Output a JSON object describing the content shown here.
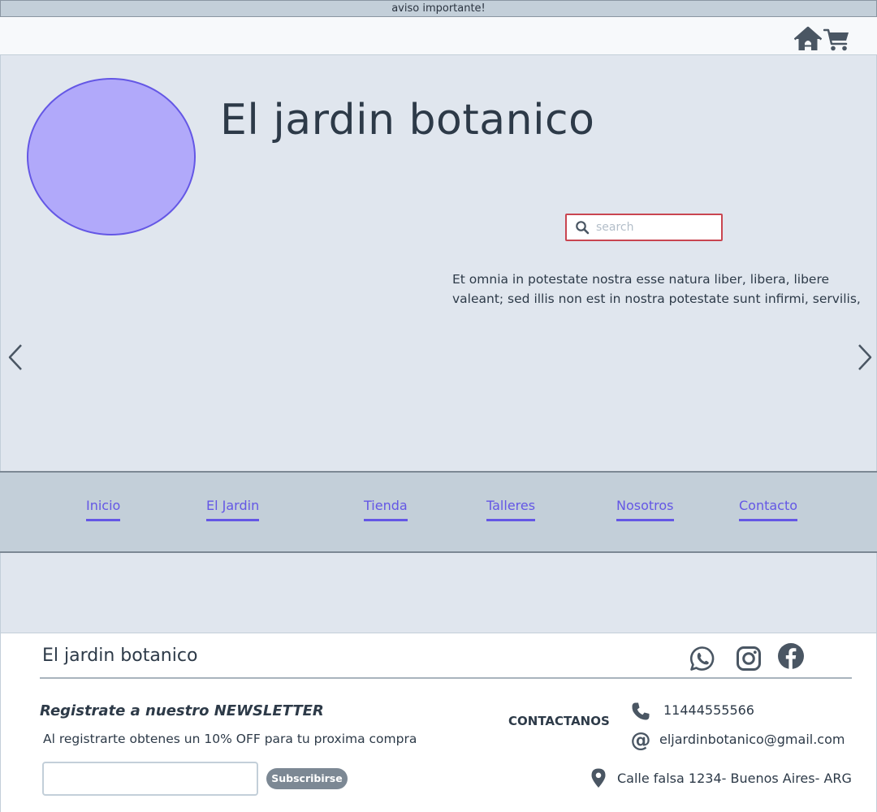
{
  "announcement": "aviso importante!",
  "topbar": {
    "icons": [
      "home-icon",
      "cart-icon"
    ]
  },
  "hero": {
    "title": "El jardin botanico",
    "search_placeholder": "search",
    "description": "Et omnia in potestate nostra esse natura liber, libera, libere valeant; sed illis non est in nostra potestate sunt infirmi, servilis,"
  },
  "nav": {
    "items": [
      {
        "label": "Inicio"
      },
      {
        "label": "El Jardin"
      },
      {
        "label": "Tienda"
      },
      {
        "label": "Talleres"
      },
      {
        "label": "Nosotros"
      },
      {
        "label": "Contacto"
      }
    ]
  },
  "footer": {
    "title": "El jardin botanico",
    "social": [
      "whatsapp-icon",
      "instagram-icon",
      "facebook-icon"
    ],
    "newsletter": {
      "title": "Registrate a nuestro NEWSLETTER",
      "subtitle": "Al registrarte obtenes un 10% OFF para tu proxima compra",
      "button": "Subscribirse"
    },
    "contact": {
      "label": "CONTACTANOS",
      "phone": "11444555566",
      "email": "eljardinbotanico@gmail.com",
      "address": "Calle falsa 1234- Buenos Aires- ARG"
    }
  },
  "colors": {
    "accent": "#6457e5",
    "logo_fill": "#b1a9fa",
    "band": "#c3cfd9",
    "hero_bg": "#e0e6ee",
    "text": "#2d3a48",
    "search_border": "#c94550"
  }
}
